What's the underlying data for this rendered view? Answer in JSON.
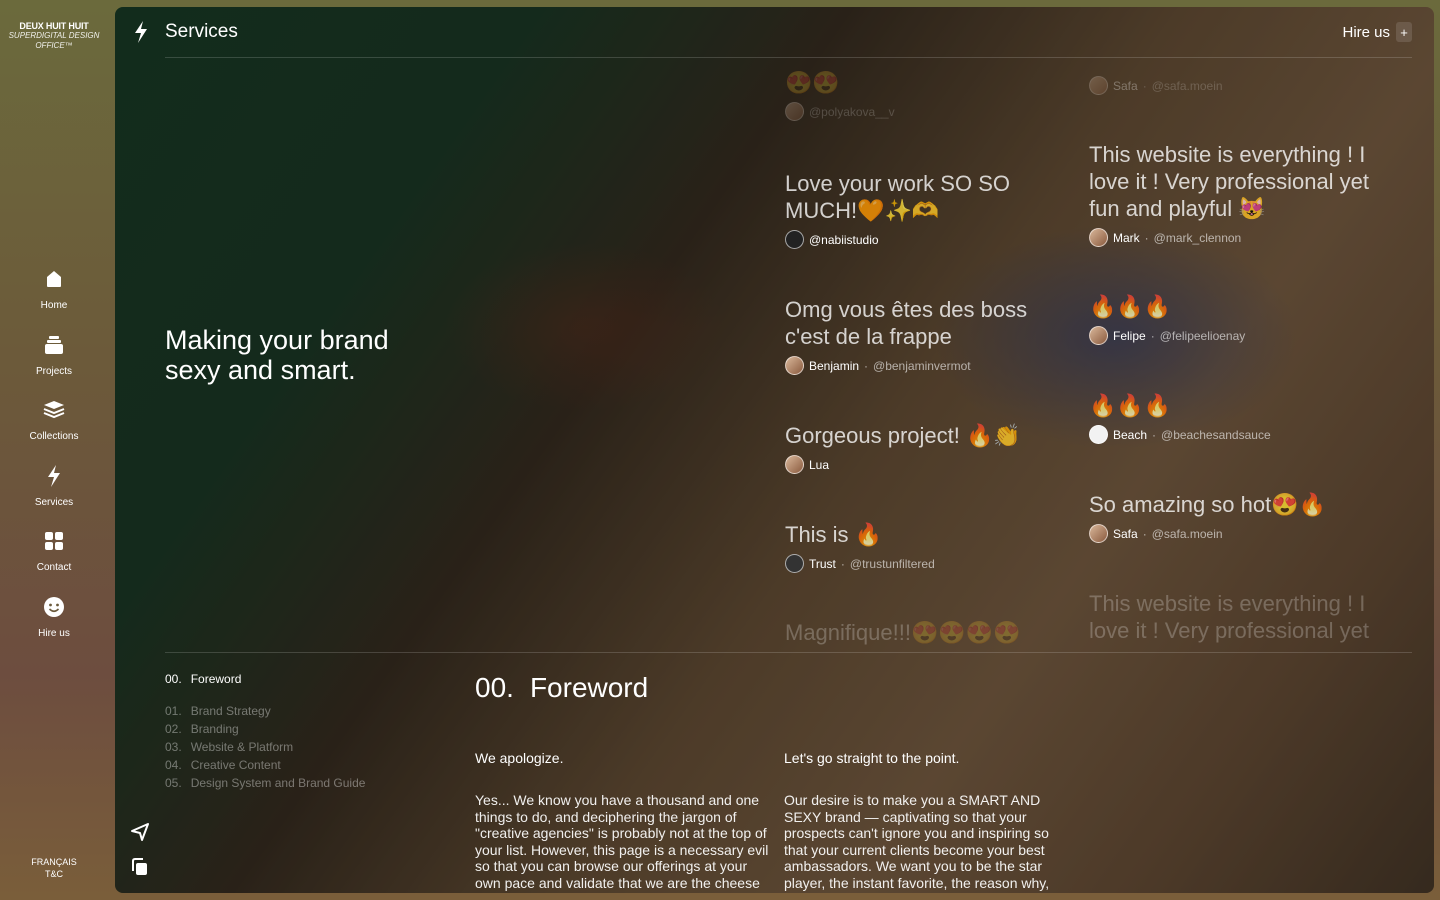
{
  "brand": {
    "name": "DEUX HUIT HUIT",
    "tagline": "SUPERDIGITAL DESIGN OFFICE™"
  },
  "nav": [
    {
      "label": "Home",
      "icon": "home-icon"
    },
    {
      "label": "Projects",
      "icon": "projects-icon"
    },
    {
      "label": "Collections",
      "icon": "collections-icon"
    },
    {
      "label": "Services",
      "icon": "bolt-icon"
    },
    {
      "label": "Contact",
      "icon": "contact-icon"
    },
    {
      "label": "Hire us",
      "icon": "smiley-icon"
    }
  ],
  "footer": {
    "language": "FRANÇAIS",
    "terms": "T&C"
  },
  "topbar": {
    "title": "Services",
    "hire_label": "Hire us",
    "hire_plus": "+"
  },
  "hero": "Making your brand sexy and smart.",
  "testimonials": {
    "left": [
      {
        "message": "😍😍",
        "name": "",
        "handle": "@polyakova__v",
        "faded": true
      },
      {
        "message": "Love your work SO SO MUCH!🧡✨🫶",
        "name": "",
        "handle": "@nabiistudio"
      },
      {
        "message": "Omg vous êtes des boss c'est de la frappe",
        "name": "Benjamin",
        "handle": "@benjaminvermot"
      },
      {
        "message": "Gorgeous project! 🔥👏",
        "name": "Lua",
        "handle": ""
      },
      {
        "message": "This is 🔥",
        "name": "Trust",
        "handle": "@trustunfiltered"
      },
      {
        "message": "Magnifique!!!😍😍😍😍",
        "name": "",
        "handle": "",
        "faded": true
      }
    ],
    "right": [
      {
        "message": "",
        "name": "Safa",
        "handle": "@safa.moein",
        "faded": true
      },
      {
        "message": "This website is everything ! I love it ! Very professional yet fun and playful 😻",
        "name": "Mark",
        "handle": "@mark_clennon"
      },
      {
        "message": "🔥🔥🔥",
        "name": "Felipe",
        "handle": "@felipeelioenay"
      },
      {
        "message": "🔥🔥🔥",
        "name": "Beach",
        "handle": "@beachesandsauce"
      },
      {
        "message": "So amazing so hot😍🔥",
        "name": "Safa",
        "handle": "@safa.moein"
      },
      {
        "message": "This website is everything ! I love it ! Very professional yet",
        "name": "",
        "handle": "",
        "faded": true
      }
    ]
  },
  "toc": {
    "active": {
      "num": "00.",
      "label": "Foreword"
    },
    "items": [
      {
        "num": "01.",
        "label": "Brand Strategy"
      },
      {
        "num": "02.",
        "label": "Branding"
      },
      {
        "num": "03.",
        "label": "Website & Platform"
      },
      {
        "num": "04.",
        "label": "Creative Content"
      },
      {
        "num": "05.",
        "label": "Design System and Brand Guide"
      }
    ]
  },
  "section": {
    "num": "00.",
    "title": "Foreword",
    "col1": {
      "heading": "We apologize.",
      "body": "Yes... We know you have a thousand and one things to do, and deciphering the jargon of \"creative agencies\" is probably not at the top of your list. However, this page is a necessary evil so that you can browse our offerings at your own pace and validate that we are the cheese missing from your poutine."
    },
    "col2": {
      "heading": "Let's go straight to the point.",
      "body": "Our desire is to make you a SMART AND SEXY brand — captivating so that your prospects can't ignore you and inspiring so that your current clients become your best ambassadors. We want you to be the star player, the instant favorite, the reason why, online or elsewhere, everyone swipes right."
    }
  },
  "colors": {
    "panel_green": "#1a3d28",
    "panel_tan": "#7e6246",
    "rail_olive": "#6b6a3c"
  }
}
